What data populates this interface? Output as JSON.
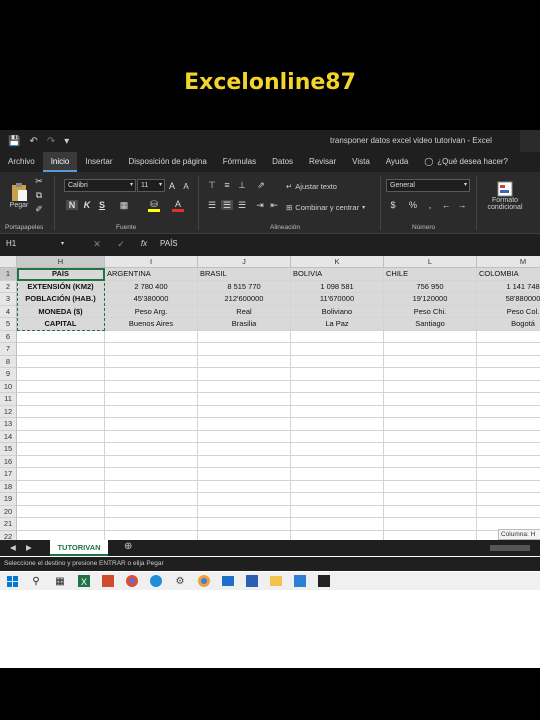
{
  "overlay": {
    "title": "Excelonline87"
  },
  "titlebar": {
    "doc_title": "transponer datos excel video tutorivan  -  Excel"
  },
  "menu": [
    "Archivo",
    "Inicio",
    "Insertar",
    "Disposición de página",
    "Fórmulas",
    "Datos",
    "Revisar",
    "Vista",
    "Ayuda"
  ],
  "tell_me": "¿Qué desea hacer?",
  "ribbon": {
    "clipboard": {
      "paste": "Pegar",
      "label": "Portapapeles"
    },
    "font": {
      "name": "Calibri",
      "size": "11",
      "bold": "N",
      "italic": "K",
      "underline": "S",
      "label": "Fuente"
    },
    "alignment": {
      "wrap": "Ajustar texto",
      "merge": "Combinar y centrar",
      "label": "Alineación"
    },
    "number": {
      "format": "General",
      "label": "Número",
      "currency": "$",
      "percent": "%"
    },
    "styles": {
      "cond_format_line1": "Formato",
      "cond_format_line2": "condicional"
    }
  },
  "formula": {
    "namebox": "H1",
    "fx": "fx",
    "value": "PAÍS"
  },
  "columns": [
    "H",
    "I",
    "J",
    "K",
    "L",
    "M"
  ],
  "rows": [
    [
      "PAÍS",
      "ARGENTINA",
      "BRASIL",
      "BOLIVIA",
      "CHILE",
      "COLOMBIA"
    ],
    [
      "EXTENSIÓN (KM2)",
      "2 780 400",
      "8 515 770",
      "1 098 581",
      "756 950",
      "1 141 748"
    ],
    [
      "POBLACIÓN (HAB.)",
      "45'380000",
      "212'600000",
      "11'670000",
      "19'120000",
      "58'880000"
    ],
    [
      "MONEDA ($)",
      "Peso Arg.",
      "Real",
      "Boliviano",
      "Peso Chi.",
      "Peso Col."
    ],
    [
      "CAPITAL",
      "Buenos Aires",
      "Brasilia",
      "La Paz",
      "Santiago",
      "Bogotá"
    ]
  ],
  "row_numbers": [
    "1",
    "2",
    "3",
    "4",
    "5",
    "6",
    "7",
    "8",
    "9",
    "10",
    "11",
    "12",
    "13",
    "14",
    "15",
    "16",
    "17",
    "18",
    "19",
    "20",
    "21",
    "22"
  ],
  "status_column": "Columna: H",
  "sheet": {
    "tab": "TUTORIVAN"
  },
  "status": "Seleccione el destino y presione ENTRAR o elija Pegar"
}
